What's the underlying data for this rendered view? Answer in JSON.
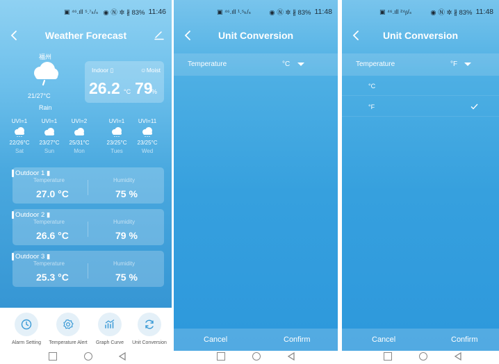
{
  "screens": [
    {
      "status": {
        "left": "▣ ⁴⁶.ıll ⁵.⁷ₖ/ₛ",
        "right": "◉ Ⓝ ✲ ∦ 83%",
        "time": "11:46"
      },
      "title": "Weather Forecast",
      "current": {
        "city": "福州",
        "temp_range": "21/27°C",
        "desc": "Rain"
      },
      "indoor": {
        "label": "Indoor",
        "moist_label": "Moist",
        "temp": "26.2",
        "temp_unit": "°C",
        "humidity": "79",
        "humidity_unit": "%"
      },
      "forecast": [
        {
          "uvi": "UVI=1",
          "temp": "22/26°C",
          "day": "Sat",
          "icon": "rain-cloud-icon"
        },
        {
          "uvi": "UVI=1",
          "temp": "23/27°C",
          "day": "Sun",
          "icon": "cloud-icon"
        },
        {
          "uvi": "UVI=2",
          "temp": "25/31°C",
          "day": "Mon",
          "icon": "cloud-icon"
        },
        {
          "uvi": "UVI=1",
          "temp": "23/25°C",
          "day": "Tues",
          "icon": "rain-cloud-icon"
        },
        {
          "uvi": "UVI=11",
          "temp": "23/25°C",
          "day": "Wed",
          "icon": "rain-cloud-icon"
        }
      ],
      "outdoor": [
        {
          "name": "Outdoor 1",
          "temp_label": "Temperature",
          "hum_label": "Humidity",
          "temp": "27.0 °C",
          "humidity": "75 %"
        },
        {
          "name": "Outdoor 2",
          "temp_label": "Temperature",
          "hum_label": "Humidity",
          "temp": "26.6 °C",
          "humidity": "79 %"
        },
        {
          "name": "Outdoor 3",
          "temp_label": "Temperature",
          "hum_label": "Humidity",
          "temp": "25.3 °C",
          "humidity": "75 %"
        }
      ],
      "nav": [
        {
          "label": "Alarm Setting",
          "icon": "clock-icon"
        },
        {
          "label": "Temperature Alert",
          "icon": "gear-icon"
        },
        {
          "label": "Graph Curve",
          "icon": "chart-icon"
        },
        {
          "label": "Unit Conversion",
          "icon": "refresh-icon"
        }
      ]
    },
    {
      "status": {
        "left": "▣ ⁴⁶.ıll ¹.⁵ₖ/ₛ",
        "right": "◉ Ⓝ ✲ ∦ 83%",
        "time": "11:48"
      },
      "title": "Unit Conversion",
      "unit_row": {
        "label": "Temperature",
        "value": "°C"
      },
      "cancel": "Cancel",
      "confirm": "Confirm"
    },
    {
      "status": {
        "left": "▣ ⁴⁶.ıll ²⁴ᵦ/ₛ",
        "right": "◉ Ⓝ ✲ ∦ 83%",
        "time": "11:48"
      },
      "title": "Unit Conversion",
      "unit_row": {
        "label": "Temperature",
        "value": "°F"
      },
      "options": [
        "°C",
        "°F"
      ],
      "selected_option": "°F",
      "cancel": "Cancel",
      "confirm": "Confirm"
    }
  ]
}
